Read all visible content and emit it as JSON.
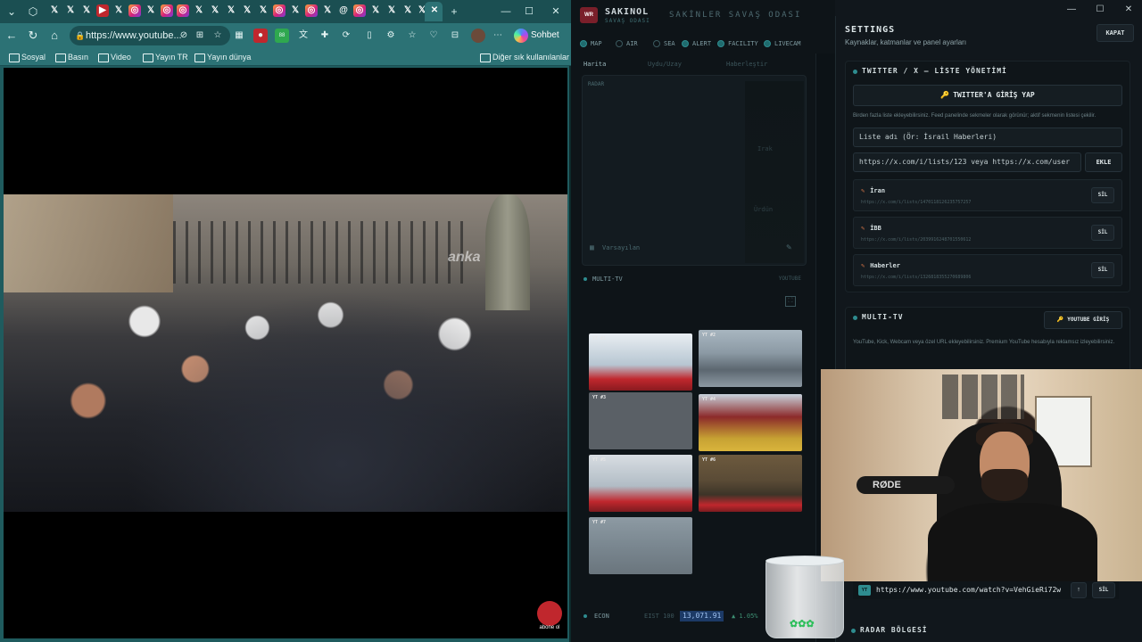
{
  "browser": {
    "url": "https://www.youtube...",
    "chat_label": "Sohbet et",
    "bookmarks": [
      "Sosyal",
      "Basın",
      "Video",
      "Yayın TR",
      "Yayın dünya"
    ],
    "other_bookmarks": "Diğer sık kullanılanlar",
    "video_watermark": "anka",
    "subscribe_badge": "abone ol"
  },
  "dashboard": {
    "brand_name": "SAKINOL",
    "brand_sub": "SAVAŞ ODASI",
    "room_title": "SAKİNLER SAVAŞ ODASI",
    "layers": [
      "MAP",
      "AIR",
      "SEA",
      "ALERT",
      "FACILITY",
      "LIVECAM"
    ],
    "map_tabs": [
      "Harita",
      "Uydu/Uzay",
      "Haberleştir"
    ],
    "radar_label": "RADAR",
    "map_label_1": "Irak",
    "map_label_2": "Ürdün",
    "preset_label": "Varsayılan",
    "multitv_title": "MULTI-TV",
    "multitv_right": "YOUTUBE",
    "tv_tags": [
      "YT #1",
      "YT #2",
      "YT #3",
      "YT #4",
      "YT #5",
      "YT #6",
      "YT #7"
    ],
    "econ_label": "ECON",
    "econ_index_name": "EIST 100",
    "econ_index_value": "13,071.91",
    "econ_index_change": "▲ 1.05%"
  },
  "settings": {
    "title": "SETTINGS",
    "subtitle": "Kaynaklar, katmanlar ve panel ayarları",
    "close_label": "KAPAT",
    "twitter_section": {
      "title": "TWITTER / X — LİSTE YÖNETİMİ",
      "login_label": "TWITTER'A GİRİŞ YAP",
      "hint": "Birden fazla liste ekleyebilirsiniz. Feed panelinde sekmeler olarak görünür; aktif sekmenin listesi çekilir.",
      "name_placeholder": "Liste adı (Ör: İsrail Haberleri)",
      "url_placeholder": "https://x.com/i/lists/123 veya https://x.com/user",
      "add_label": "EKLE",
      "lists": [
        {
          "name": "İran",
          "url": "https://x.com/i/lists/1470118126235757257"
        },
        {
          "name": "İBB",
          "url": "https://x.com/i/lists/2039916248701550612"
        },
        {
          "name": "Haberler",
          "url": "https://x.com/i/lists/1326818355270689806"
        }
      ],
      "delete_label": "SİL"
    },
    "multitv_section": {
      "title": "MULTI-TV",
      "yt_login_label": "YOUTUBE GİRİŞ",
      "hint": "YouTube, Kick, Webcam veya özel URL ekleyebilirsiniz. Premium YouTube hesabıyla reklamsız izleyebilirsiniz.",
      "badge": "YT",
      "url": "https://www.youtube.com/watch?v=VehGieRi72w",
      "up_label": "↑",
      "delete_label": "SİL"
    },
    "radar_section": {
      "title": "RADAR BÖLGESİ"
    }
  }
}
